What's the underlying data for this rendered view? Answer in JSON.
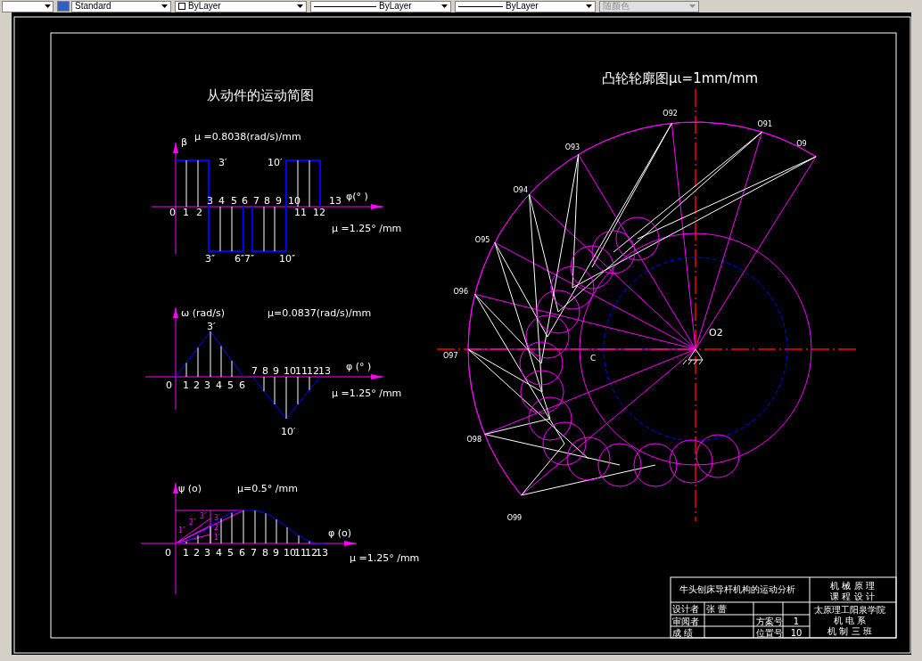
{
  "toolbar": {
    "controls": [
      {
        "kind": "style",
        "value": "Standard",
        "disabled": false
      },
      {
        "kind": "layer",
        "value": "ByLayer",
        "disabled": false
      },
      {
        "kind": "linetype",
        "value": "ByLayer",
        "disabled": false
      },
      {
        "kind": "lineweight",
        "value": "ByLayer",
        "disabled": false
      },
      {
        "kind": "color",
        "value": "随颜色",
        "disabled": true
      }
    ]
  },
  "drawing": {
    "left_title": "从动件的运动简图",
    "charts": [
      {
        "kind": "square",
        "y_label": "β",
        "y_scale": "μ =0.8038(rad/s)/mm",
        "x_label": "φ(° )",
        "x_scale": "μ =1.25° /mm",
        "points": [
          "0",
          "1",
          "2",
          "3",
          "4",
          "5",
          "6",
          "7",
          "8",
          "9",
          "10",
          "11",
          "12",
          "13"
        ],
        "marks": [
          "3′",
          "10′",
          "3″",
          "6″7″",
          "10″"
        ]
      },
      {
        "kind": "triangle",
        "y_label": "ω (rad/s)",
        "y_scale": "μ=0.0837(rad/s)/mm",
        "x_label": "φ (° )",
        "x_scale": "μ =1.25° /mm",
        "points": [
          "0",
          "1",
          "2",
          "3",
          "4",
          "5",
          "6",
          "7",
          "8",
          "9",
          "10",
          "11",
          "12",
          "13"
        ],
        "marks": [
          "3′",
          "10′"
        ]
      },
      {
        "kind": "curve",
        "y_label": "ψ (o)",
        "y_scale": "μ=0.5° /mm",
        "x_label": "φ (o)",
        "x_scale": "μ =1.25° /mm",
        "points": [
          "0",
          "1",
          "2",
          "3",
          "4",
          "5",
          "6",
          "7",
          "8",
          "9",
          "10",
          "11",
          "12",
          "13"
        ],
        "marks": [
          "1″",
          "2″",
          "3″",
          "3′",
          "2′",
          "1′"
        ]
      }
    ],
    "cam_title": "凸轮轮廓图μι=1mm/mm",
    "cam_points": [
      "O9",
      "O91",
      "O92",
      "O93",
      "O94",
      "O95",
      "O96",
      "O97",
      "O98",
      "O99"
    ],
    "pivot_label": "O2",
    "contact_label": "C",
    "title_block": {
      "drawing_title": "牛头刨床导杆机构的运动分析",
      "course": [
        "机 械 原 理",
        "课 程 设 计"
      ],
      "rows": [
        [
          "设计者",
          "张 蕾",
          "",
          ""
        ],
        [
          "审阅者",
          "",
          "方案号",
          "1"
        ],
        [
          "成 绩",
          "",
          "位置号",
          "10"
        ]
      ],
      "school": [
        "太原理工阳泉学院",
        "机 电 系",
        "机 制 三 班"
      ]
    }
  }
}
